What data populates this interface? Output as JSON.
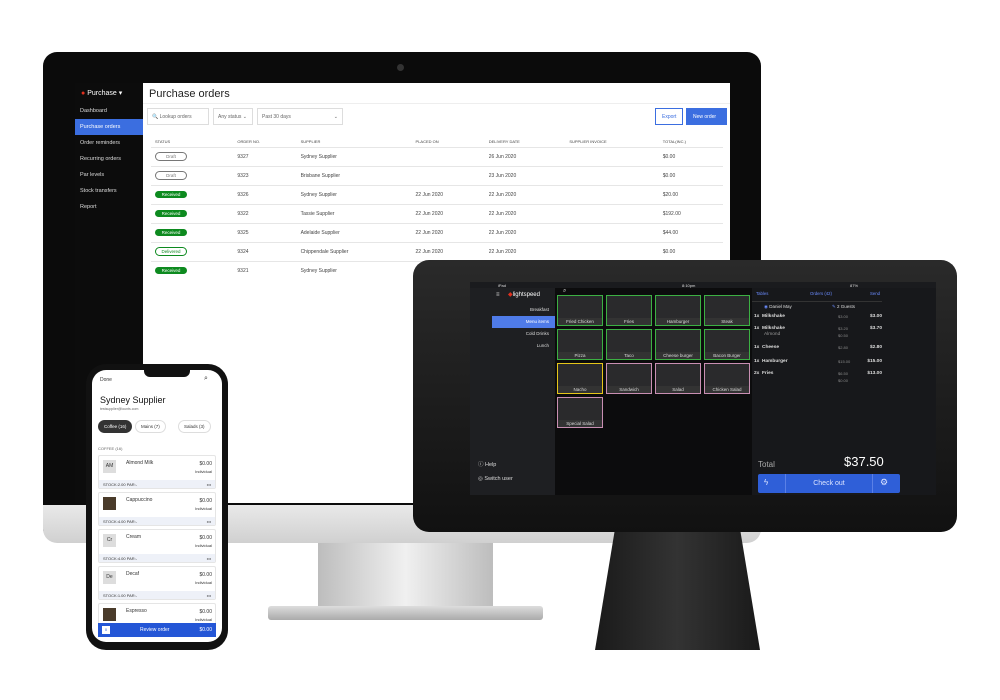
{
  "desktop": {
    "sidebar": {
      "brand": "Purchase",
      "items": [
        "Dashboard",
        "Purchase orders",
        "Order reminders",
        "Recurring orders",
        "Par levels",
        "Stock transfers",
        "Report"
      ],
      "active": 1
    },
    "title": "Purchase orders",
    "search_placeholder": "Lookup orders",
    "status_filter": "Any status",
    "date_filter": "Past 30 days",
    "export": "Export",
    "new_order": "New order",
    "columns": [
      "STATUS",
      "ORDER NO.",
      "SUPPLIER",
      "PLACED ON",
      "DELIVERY DATE",
      "SUPPLIER INVOICE",
      "TOTAL(INC.)"
    ],
    "rows": [
      [
        "Draft",
        "9327",
        "Sydney Supplier",
        "",
        "26 Jun 2020",
        "",
        "$0.00"
      ],
      [
        "Draft",
        "9323",
        "Brisbane Supplier",
        "",
        "23 Jun 2020",
        "",
        "$0.00"
      ],
      [
        "Received",
        "9326",
        "Sydney Supplier",
        "22 Jun 2020",
        "22 Jun 2020",
        "",
        "$20.00"
      ],
      [
        "Received",
        "9322",
        "Tassie Supplier",
        "22 Jun 2020",
        "22 Jun 2020",
        "",
        "$192.00"
      ],
      [
        "Received",
        "9325",
        "Adelaide Supplier",
        "22 Jun 2020",
        "22 Jun 2020",
        "",
        "$44.00"
      ],
      [
        "Delivered",
        "9324",
        "Chippendale Supplier",
        "22 Jun 2020",
        "22 Jun 2020",
        "",
        "$0.00"
      ],
      [
        "Received",
        "9321",
        "Sydney Supplier",
        "22 Jun 2020",
        "22 Jun 2020",
        "",
        "$0.00"
      ]
    ],
    "accent": "#3b6ee0"
  },
  "phone": {
    "done": "Done",
    "title": "Sydney Supplier",
    "email": "testsupplier@lounts.com",
    "chips": [
      "Coffee (16)",
      "Mains (7)",
      "Salads (3)"
    ],
    "section": "COFFEE (16)",
    "items": [
      {
        "thumb": "AM",
        "name": "Almond Milk",
        "price": "$0.00",
        "unit": "Individual",
        "stock": "STOCK:2.00  PAR:-"
      },
      {
        "thumb": "",
        "name": "Cappuccino",
        "price": "$0.00",
        "unit": "Individual",
        "stock": "STOCK:4.00  PAR:-"
      },
      {
        "thumb": "Cr",
        "name": "Cream",
        "price": "$0.00",
        "unit": "Individual",
        "stock": "STOCK:4.00  PAR:-"
      },
      {
        "thumb": "De",
        "name": "Decaf",
        "price": "$0.00",
        "unit": "Individual",
        "stock": "STOCK:1.00  PAR:-"
      },
      {
        "thumb": "",
        "name": "Espresso",
        "price": "$0.00",
        "unit": "Individual",
        "stock": ""
      }
    ],
    "review_count": "0",
    "review": "Review order",
    "review_total": "$0.00"
  },
  "tablet": {
    "status_left": "iPad",
    "status_time": "8:10pm",
    "battery": "87%",
    "brand": "lightspeed",
    "categories": [
      "Breakfast",
      "Menu items",
      "Cold Drinks",
      "Lunch"
    ],
    "active_category": 1,
    "tiles": [
      {
        "name": "Fried Chicken",
        "color": "#3cb043"
      },
      {
        "name": "Fries",
        "color": "#3cb043"
      },
      {
        "name": "Hamburger",
        "color": "#3cb043"
      },
      {
        "name": "Steak",
        "color": "#3cb043"
      },
      {
        "name": "Pizza",
        "color": "#3cb043"
      },
      {
        "name": "Taco",
        "color": "#3cb043"
      },
      {
        "name": "Cheese burger",
        "color": "#3cb043"
      },
      {
        "name": "Bacon Burger",
        "color": "#3cb043"
      },
      {
        "name": "Nacho",
        "color": "#e6c619"
      },
      {
        "name": "Sandwich",
        "color": "#c98fb3"
      },
      {
        "name": "Salad",
        "color": "#c98fb3"
      },
      {
        "name": "Chicken Salad",
        "color": "#c98fb3"
      },
      {
        "name": "Special Salad",
        "color": "#c98fb3"
      }
    ],
    "help": "Help",
    "switch_user": "Switch user",
    "tabs": [
      "Tables",
      "Orders (42)",
      "Send"
    ],
    "customer": "Daniel May",
    "guests": "2 Guests",
    "lines": [
      {
        "qty": "1x",
        "name": "Milkshake",
        "sub": "",
        "unit": "$3.00",
        "mod": "",
        "total": "$3.00"
      },
      {
        "qty": "1x",
        "name": "Milkshake",
        "sub": "Almond",
        "unit": "$3.20",
        "mod": "$0.50",
        "total": "$3.70"
      },
      {
        "qty": "1x",
        "name": "Cheese",
        "sub": "",
        "unit": "$2.80",
        "mod": "",
        "total": "$2.80"
      },
      {
        "qty": "1x",
        "name": "Hamburger",
        "sub": "",
        "unit": "$15.00",
        "mod": "",
        "total": "$15.00"
      },
      {
        "qty": "2x",
        "name": "Fries",
        "sub": "",
        "unit": "$6.50",
        "mod": "$0.00",
        "total": "$13.00"
      }
    ],
    "total_label": "Total",
    "total": "$37.50",
    "checkout": "Check out"
  }
}
